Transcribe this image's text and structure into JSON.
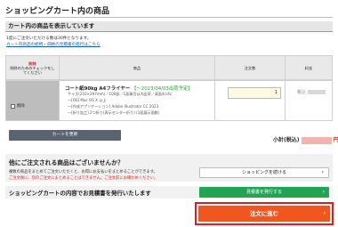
{
  "page_title": "ショッピングカート内の商品",
  "cart_section": {
    "heading": "カート内の商品を表示しています",
    "note": "1度にご注文いただける数は30件となります。",
    "link_text": "カート内商品の絵柄・価格の見積書の発行はこちら"
  },
  "table": {
    "headers": {
      "delete": "削除のためのチェックをしてください",
      "delete_red": "削除",
      "product": "商品",
      "quantity": "注文数",
      "price": "料金"
    },
    "rows": [
      {
        "delete_label": "削除",
        "name": "コート紙90kg A4フライヤー",
        "date": "【〜2023/04/03出荷予定】",
        "specs": [
          "サイズ(210×297mm)／100部／1面事目以内出荷／表面4c/4c",
          "―[OS] Mac OS X 以上",
          "―[作成アプリケーション] Adobe Illustrator CC 2023",
          "―[折り加工] 2つ折り(表示センター折り) (1面展示面数)"
        ],
        "quantity": "1",
        "price_prefix": "税込"
      }
    ]
  },
  "subtotal": {
    "label": "小計(税込)",
    "suffix": "円"
  },
  "update_button": "カートを更新",
  "other_products": {
    "title": "他にご注文される商品はございませんか？",
    "text1": "複数の商品をまとめてご注文いただくと、お得にお支払いをまとめることができます。",
    "text2": "ご注文後に、別のご注文にまとめることはできません。ご注文前にお確かめください。",
    "button": "ショッピングを続ける"
  },
  "quote": {
    "title": "ショッピングカートの内容でお見積書を発行いたします",
    "button": "見積書を発行する"
  },
  "order_button": "注文に進む",
  "icons": {
    "chevron": "chevron-right-icon"
  },
  "colors": {
    "accent_orange": "#f1561f",
    "order_frame_red": "#e31b1b",
    "green": "#22a454",
    "gray_button": "#5a6470",
    "date_green": "#2e9b3a",
    "subtotal_red": "#d9221c"
  }
}
